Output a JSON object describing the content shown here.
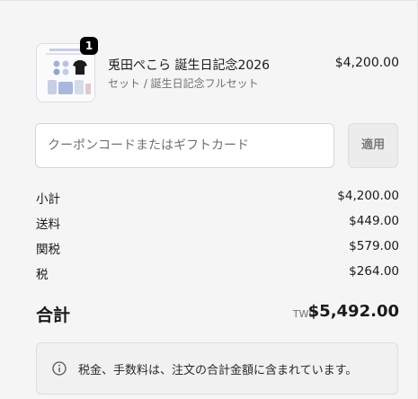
{
  "item": {
    "quantity": "1",
    "title": "兎田ぺこら 誕生日記念2026",
    "variant": "セット / 誕生日記念フルセット",
    "price": "$4,200.00"
  },
  "coupon": {
    "placeholder": "クーポンコードまたはギフトカード",
    "apply_label": "適用"
  },
  "summary": {
    "rows": [
      {
        "label": "小計",
        "value": "$4,200.00"
      },
      {
        "label": "送料",
        "value": "$449.00"
      },
      {
        "label": "関税",
        "value": "$579.00"
      },
      {
        "label": "税",
        "value": "$264.00"
      }
    ],
    "total_label": "合計",
    "currency": "TWD",
    "total_value": "$5,492.00"
  },
  "notice": {
    "text": "税金、手数料は、注文の合計金額に含まれています。"
  },
  "colors": {
    "background": "#f5f5f5",
    "badge": "#000000",
    "muted_text": "#707070"
  }
}
